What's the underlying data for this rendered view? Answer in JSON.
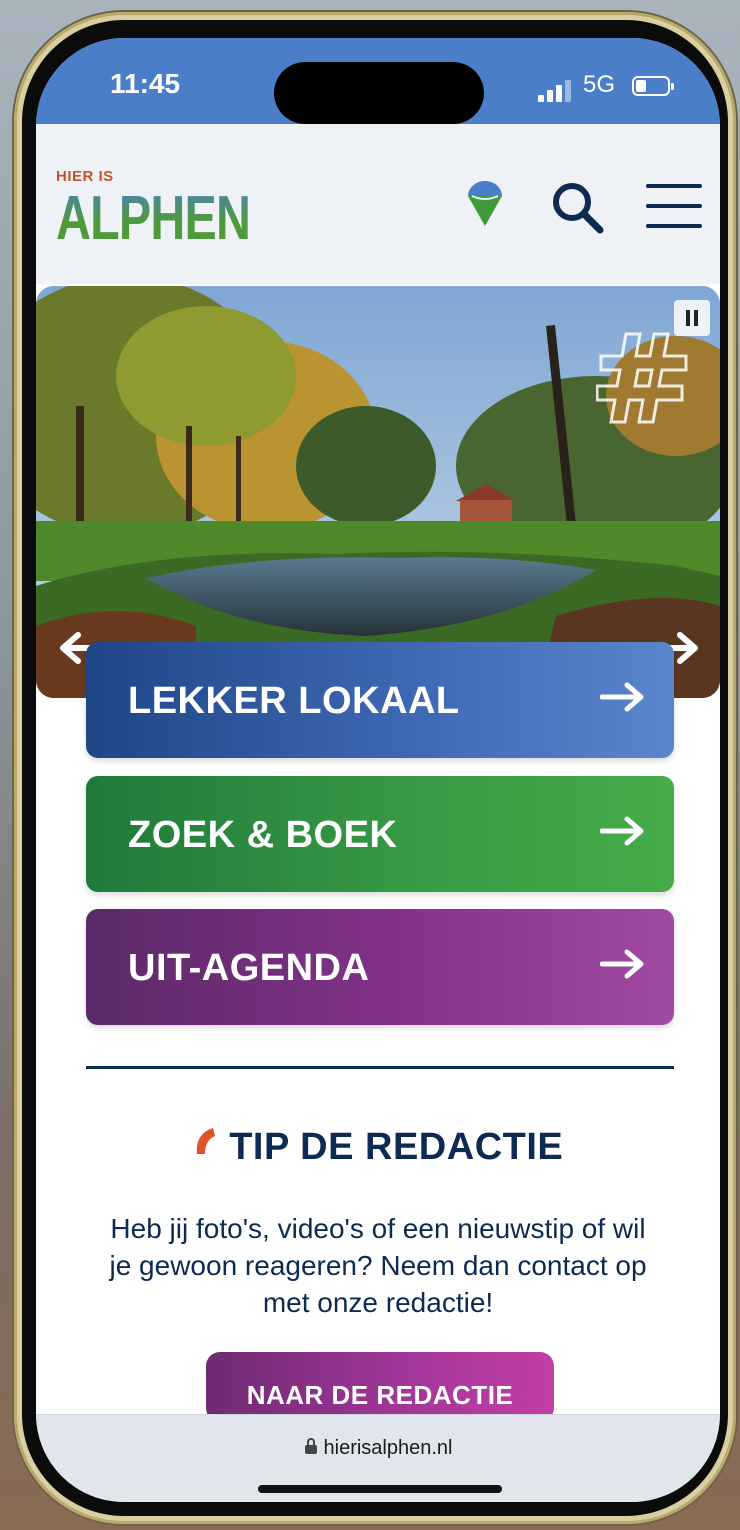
{
  "status_bar": {
    "time": "11:45",
    "network": "5G"
  },
  "header": {
    "logo_small": "HIER IS",
    "logo_main": "ALPHEN",
    "icons": [
      "location-pin-icon",
      "search-icon",
      "menu-icon"
    ]
  },
  "hero": {
    "controls": [
      "pause-icon",
      "arrow-left-icon",
      "arrow-right-icon"
    ]
  },
  "nav_tiles": [
    {
      "label": "LEKKER LOKAAL",
      "color": "#2f5aa8"
    },
    {
      "label": "ZOEK & BOEK",
      "color": "#2f8f3e"
    },
    {
      "label": "UIT-AGENDA",
      "color": "#7a2f7f"
    }
  ],
  "tip": {
    "title": "TIP DE REDACTIE",
    "body": "Heb jij foto's, video's of een nieuwstip of wil je gewoon reageren? Neem dan contact op met onze redactie!",
    "button_label": "NAAR DE REDACTIE"
  },
  "browser": {
    "url": "hierisalphen.nl"
  },
  "colors": {
    "brand_navy": "#0d2a52",
    "brand_blue": "#4a7ec8",
    "brand_green": "#4f9a3a",
    "brand_orange": "#e0532a",
    "brand_purple": "#a0369a"
  }
}
